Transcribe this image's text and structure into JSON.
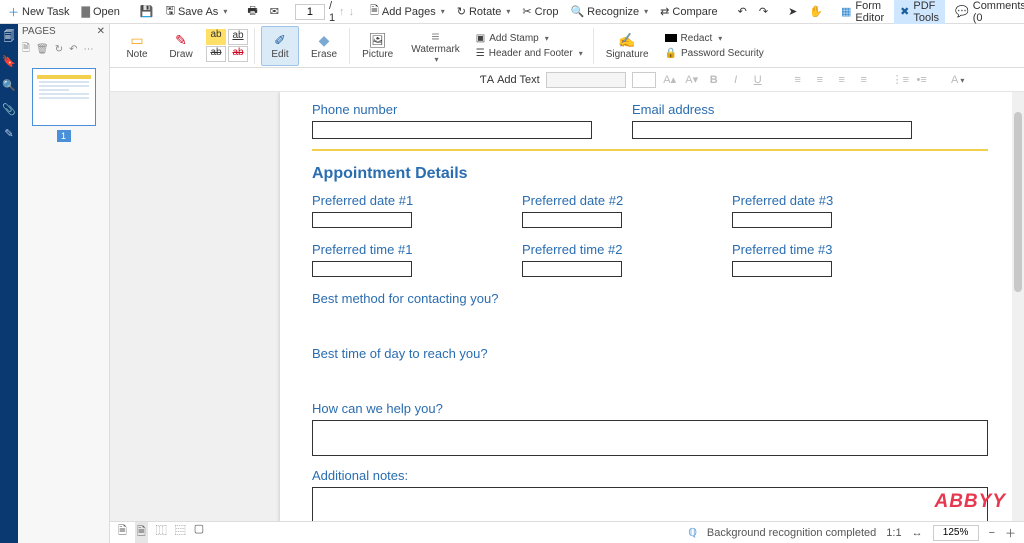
{
  "topbar": {
    "new_task": "New Task",
    "open": "Open",
    "save_as": "Save As",
    "page_current": "1",
    "page_total": "/ 1",
    "add_pages": "Add Pages",
    "rotate": "Rotate",
    "crop": "Crop",
    "recognize": "Recognize",
    "compare": "Compare",
    "form_editor": "Form Editor",
    "pdf_tools": "PDF Tools",
    "comments": "Comments (0"
  },
  "pages": {
    "title": "PAGES",
    "thumb_num": "1"
  },
  "ribbon": {
    "note": "Note",
    "draw": "Draw",
    "edit": "Edit",
    "erase": "Erase",
    "picture": "Picture",
    "watermark": "Watermark",
    "add_stamp": "Add Stamp",
    "header_footer": "Header and Footer",
    "signature": "Signature",
    "redact": "Redact",
    "password_security": "Password Security"
  },
  "fmt": {
    "add_text": "Add Text"
  },
  "form": {
    "phone": "Phone number",
    "email": "Email address",
    "section": "Appointment Details",
    "date1": "Preferred date #1",
    "date2": "Preferred date #2",
    "date3": "Preferred date #3",
    "time1": "Preferred time #1",
    "time2": "Preferred time #2",
    "time3": "Preferred time #3",
    "contact_method": "Best method for contacting you?",
    "best_time": "Best time of day to reach you?",
    "help": "How can we help you?",
    "notes": "Additional notes:"
  },
  "status": {
    "recognition": "Background recognition completed",
    "scale": "1:1",
    "zoom": "125%"
  },
  "watermark_brand": "ABBYY"
}
